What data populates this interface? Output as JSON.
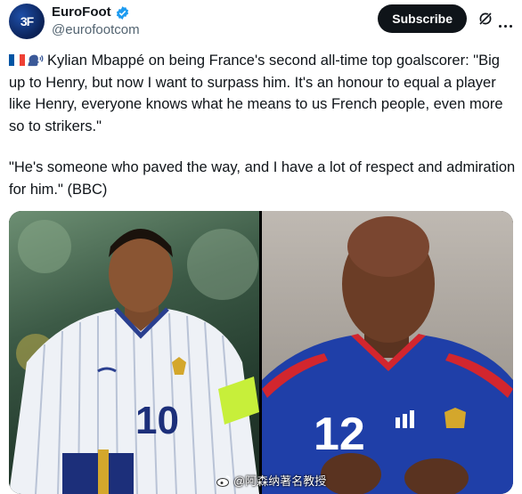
{
  "account": {
    "name": "EuroFoot",
    "handle": "@eurofootcom",
    "avatar_text": "3F"
  },
  "actions": {
    "subscribe_label": "Subscribe"
  },
  "post": {
    "paragraph1": "Kylian Mbappé on being France's second all-time top goalscorer: \"Big up to Henry, but now I want to surpass him. It's an honour to equal a player like Henry, everyone knows what he means to us French people, even more so to strikers.\"",
    "paragraph2": "\"He's someone who paved the way, and I have a lot of respect and admiration for him.\" (BBC)",
    "leading_icons": [
      "france-flag-icon",
      "speaking-head-icon"
    ]
  },
  "media": {
    "left_shirt_number": "10",
    "right_shirt_number": "12",
    "watermark": "@阿森纳著名教授"
  },
  "colors": {
    "subscribe_bg": "#0f1419",
    "verified": "#1d9bf0",
    "handle": "#536471"
  }
}
